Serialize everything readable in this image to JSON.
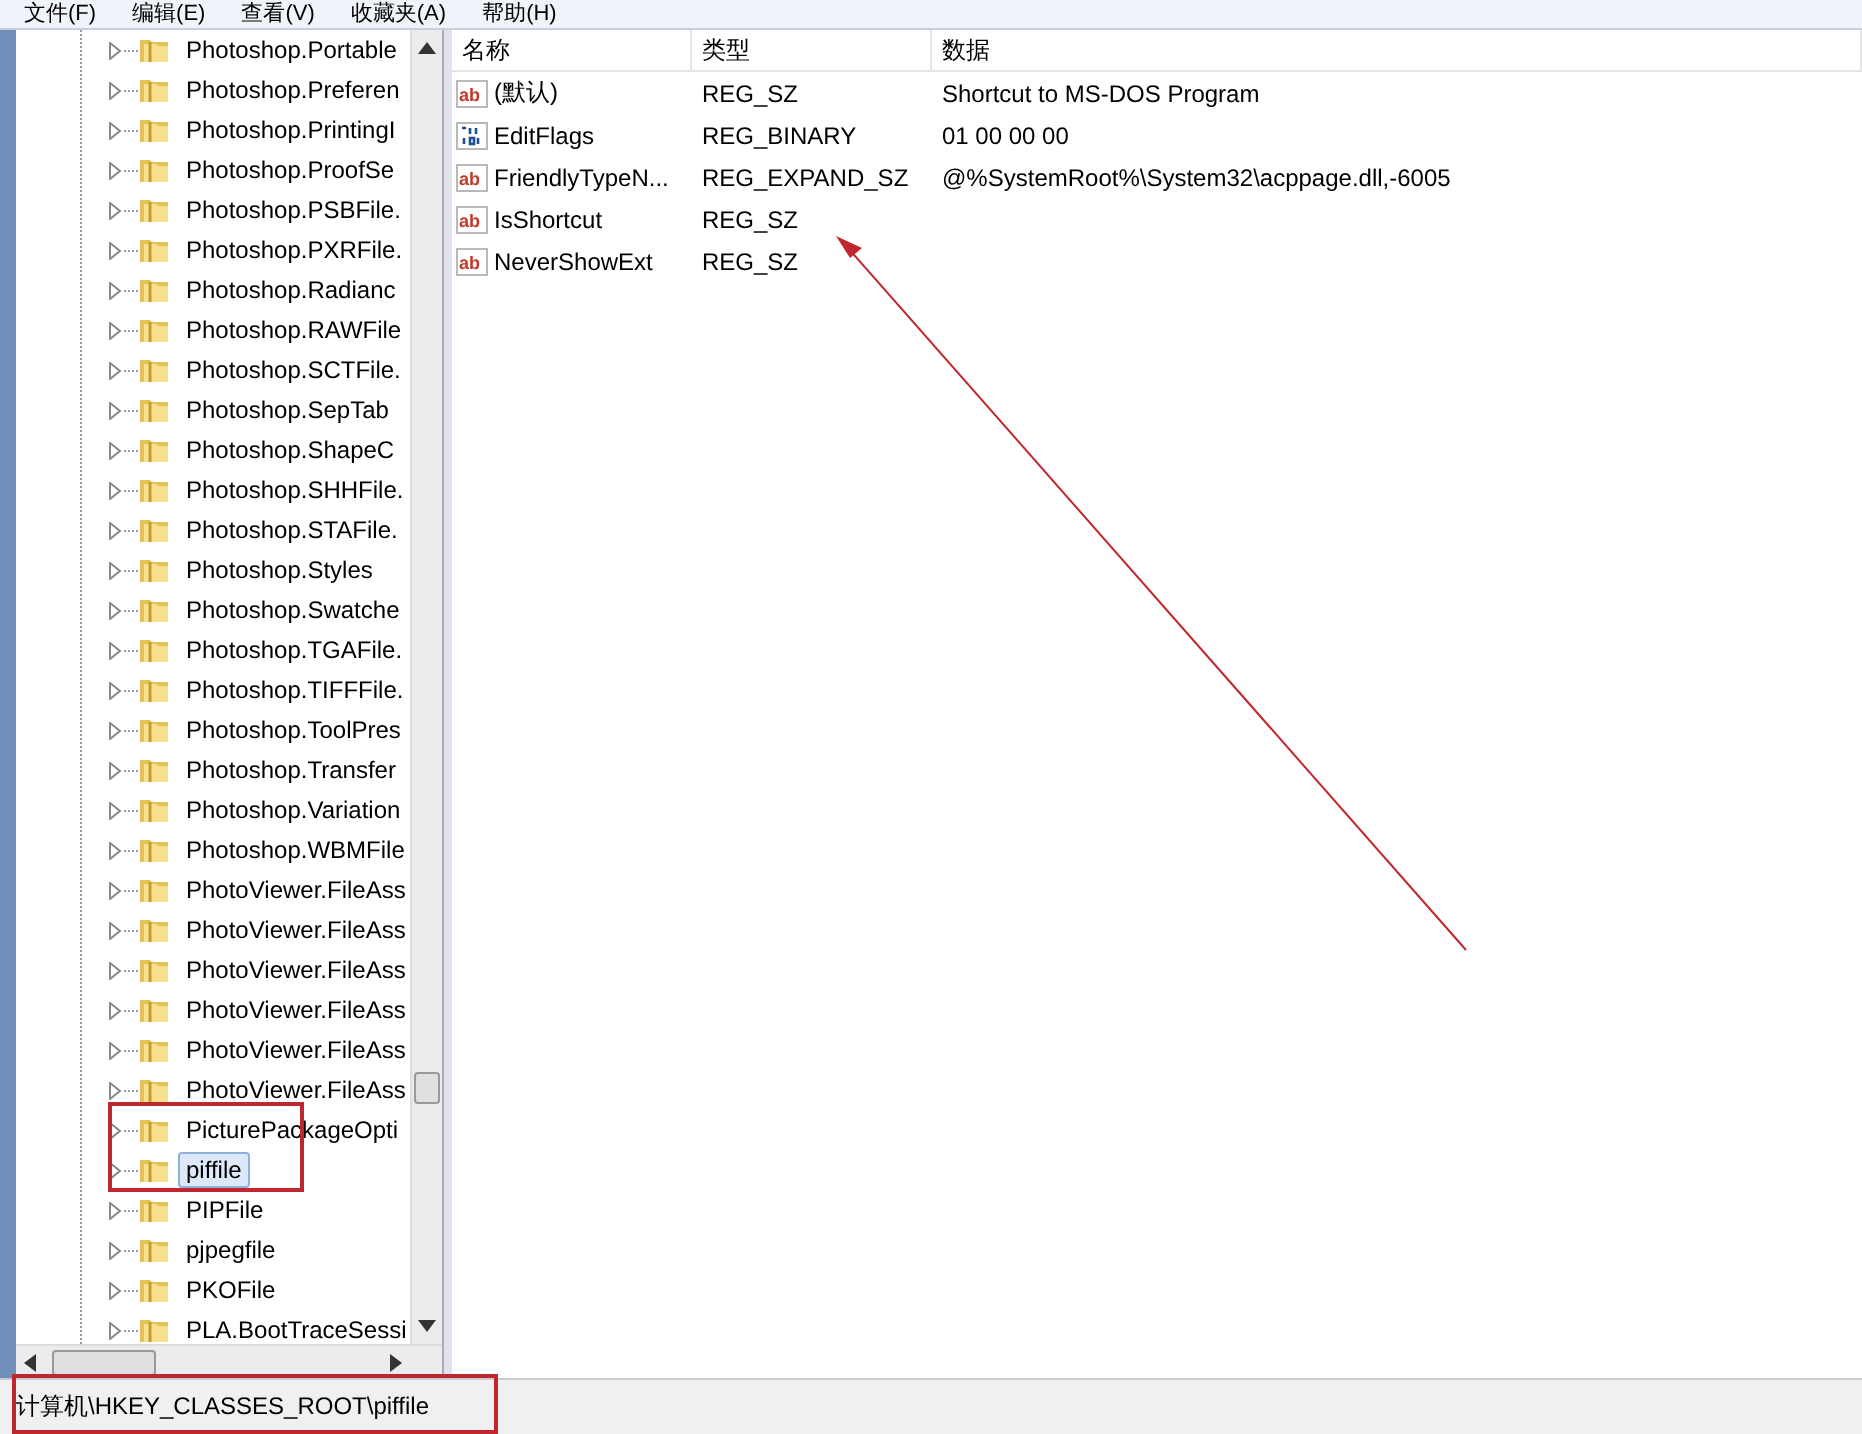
{
  "menu": [
    "文件(F)",
    "编辑(E)",
    "查看(V)",
    "收藏夹(A)",
    "帮助(H)"
  ],
  "tree": [
    {
      "label": "Photoshop.Portable",
      "selected": false
    },
    {
      "label": "Photoshop.Preferen",
      "selected": false
    },
    {
      "label": "Photoshop.PrintingI",
      "selected": false
    },
    {
      "label": "Photoshop.ProofSe",
      "selected": false
    },
    {
      "label": "Photoshop.PSBFile.",
      "selected": false
    },
    {
      "label": "Photoshop.PXRFile.",
      "selected": false
    },
    {
      "label": "Photoshop.Radianc",
      "selected": false
    },
    {
      "label": "Photoshop.RAWFile",
      "selected": false
    },
    {
      "label": "Photoshop.SCTFile.",
      "selected": false
    },
    {
      "label": "Photoshop.SepTab",
      "selected": false
    },
    {
      "label": "Photoshop.ShapeC",
      "selected": false
    },
    {
      "label": "Photoshop.SHHFile.",
      "selected": false
    },
    {
      "label": "Photoshop.STAFile.",
      "selected": false
    },
    {
      "label": "Photoshop.Styles",
      "selected": false
    },
    {
      "label": "Photoshop.Swatche",
      "selected": false
    },
    {
      "label": "Photoshop.TGAFile.",
      "selected": false
    },
    {
      "label": "Photoshop.TIFFFile.",
      "selected": false
    },
    {
      "label": "Photoshop.ToolPres",
      "selected": false
    },
    {
      "label": "Photoshop.Transfer",
      "selected": false
    },
    {
      "label": "Photoshop.Variation",
      "selected": false
    },
    {
      "label": "Photoshop.WBMFile",
      "selected": false
    },
    {
      "label": "PhotoViewer.FileAss",
      "selected": false
    },
    {
      "label": "PhotoViewer.FileAss",
      "selected": false
    },
    {
      "label": "PhotoViewer.FileAss",
      "selected": false
    },
    {
      "label": "PhotoViewer.FileAss",
      "selected": false
    },
    {
      "label": "PhotoViewer.FileAss",
      "selected": false
    },
    {
      "label": "PhotoViewer.FileAss",
      "selected": false
    },
    {
      "label": "PicturePackageOpti",
      "selected": false
    },
    {
      "label": "piffile",
      "selected": true
    },
    {
      "label": "PIPFile",
      "selected": false
    },
    {
      "label": "pjpegfile",
      "selected": false
    },
    {
      "label": "PKOFile",
      "selected": false
    },
    {
      "label": "PLA.BootTraceSessi",
      "selected": false
    }
  ],
  "values": {
    "columns": [
      "名称",
      "类型",
      "数据"
    ],
    "rows": [
      {
        "kind": "string",
        "icon": "ab",
        "name": "(默认)",
        "type": "REG_SZ",
        "data": "Shortcut to MS-DOS Program"
      },
      {
        "kind": "binary",
        "name": "EditFlags",
        "type": "REG_BINARY",
        "data": "01 00 00 00"
      },
      {
        "kind": "string",
        "icon": "ab",
        "name": "FriendlyTypeN...",
        "type": "REG_EXPAND_SZ",
        "data": "@%SystemRoot%\\System32\\acppage.dll,-6005"
      },
      {
        "kind": "string",
        "icon": "ab",
        "name": "IsShortcut",
        "type": "REG_SZ"
      },
      {
        "kind": "string",
        "icon": "ab",
        "name": "NeverShowExt",
        "type": "REG_SZ"
      }
    ]
  },
  "status_bar": "计算机\\HKEY_CLASSES_ROOT\\piffile"
}
